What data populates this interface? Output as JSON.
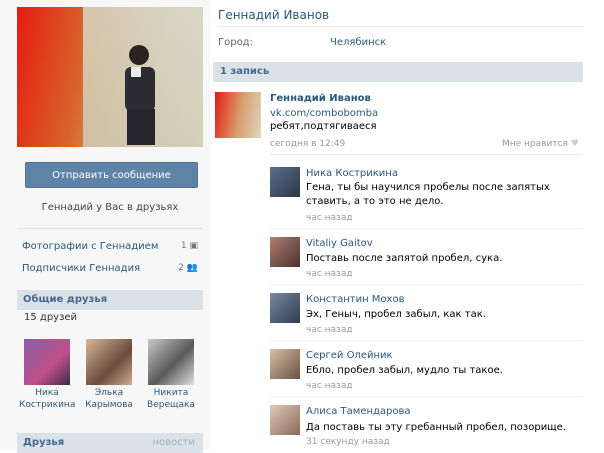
{
  "profile": {
    "name": "Геннадий Иванов",
    "city_label": "Город:",
    "city_value": "Челябинск"
  },
  "left": {
    "send_message_label": "Отправить сообщение",
    "friends_note": "Геннадий у Вас в друзьях",
    "links": [
      {
        "label": "Фотографии с Геннадием",
        "count": "1"
      },
      {
        "label": "Подписчики Геннадия",
        "count": "2"
      }
    ],
    "mutual_title": "Общие друзья",
    "mutual_count": "15 друзей",
    "mutual_friends": [
      {
        "first": "Ника",
        "last": "Кострикина"
      },
      {
        "first": "Элька",
        "last": "Карымова"
      },
      {
        "first": "Никита",
        "last": "Верещака"
      }
    ],
    "friends_title": "Друзья",
    "friends_news": "новости"
  },
  "wall": {
    "header": "1 запись",
    "post": {
      "author": "Геннадий Иванов",
      "link": "vk.com/combobomba",
      "text": "ребят,подтягиваеся",
      "time": "сегодня в 12:49",
      "like_label": "Мне нравится"
    },
    "comments": [
      {
        "author": "Ника Кострикина",
        "text": "Гена, ты бы научился пробелы после запятых ставить, а то это не дело.",
        "time": "час назад"
      },
      {
        "author": "Vitaliy Gaitov",
        "text": "Поставь после запятой пробел, сука.",
        "time": "час назад"
      },
      {
        "author": "Константин Мохов",
        "text": "Эх, Геныч, пробел забыл, как так.",
        "time": "час назад"
      },
      {
        "author": "Сергей Олейник",
        "text": "Ебло, пробел забыл, мудло ты такое.",
        "time": "час назад"
      },
      {
        "author": "Алиса Тамендарова",
        "text": "Да поставь ты эту гребанный пробел, позорище.",
        "time": "31 секунду назад"
      }
    ]
  }
}
